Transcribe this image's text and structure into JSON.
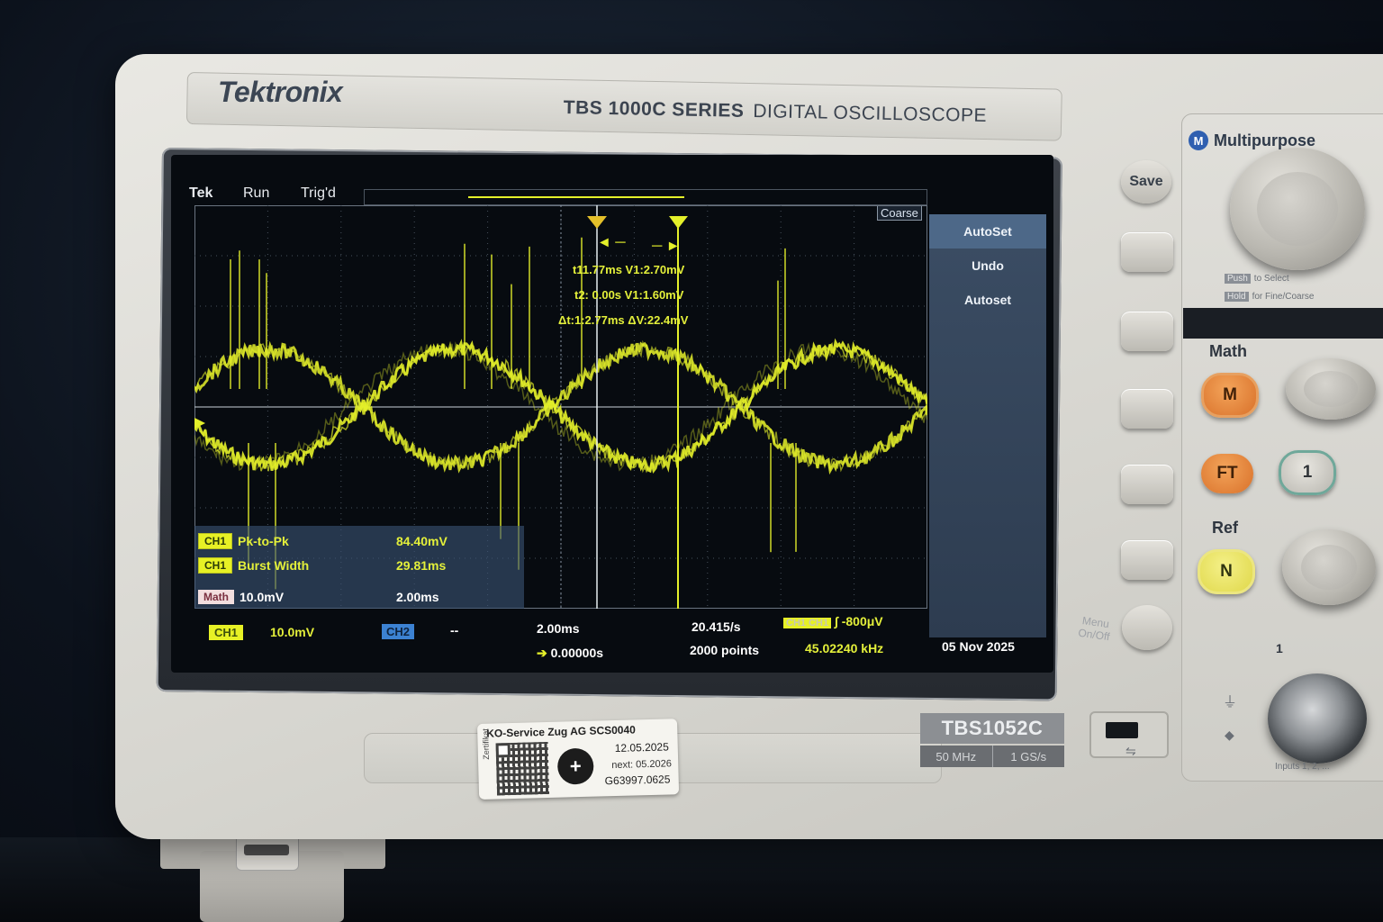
{
  "brand": "Tektronix",
  "series": {
    "name": "TBS 1000C SERIES",
    "desc": "DIGITAL OSCILLOSCOPE"
  },
  "screen": {
    "header": {
      "tek": "Tek",
      "run": "Run",
      "trig": "Trig'd",
      "coarse": "Coarse"
    },
    "cursors": {
      "line1": "t11.77ms V1:2.70mV",
      "line2": "t2: 0.00s V1:1.60mV",
      "line3": "Δt:1:2.77ms ΔV:22.4mV"
    },
    "side_menu": [
      "AutoSet",
      "Undo",
      "Autoset"
    ],
    "measurements": [
      {
        "channel": "CH1",
        "label": "Pk-to-Pk",
        "value": "84.40mV"
      },
      {
        "channel": "CH1",
        "label": "Burst Width",
        "value": "29.81ms"
      }
    ],
    "math_row": {
      "tag": "Math",
      "scale": "10.0mV",
      "time": "2.00ms"
    },
    "status": {
      "ch1_tag": "CH1",
      "ch1_scale": "10.0mV",
      "ch2_tag": "CH2",
      "ch2_scale": "--",
      "timebase": "2.00ms",
      "delay": "0.00000s",
      "sample_rate": "20.415/s",
      "record": "2000 points",
      "trig_tag": "CH1 CH1",
      "trig_level": "-800μV",
      "frequency": "45.02240 kHz",
      "date": "05 Nov 2025"
    }
  },
  "front_panel": {
    "save_label": "Save",
    "menu_onoff": "Menu On/Off",
    "multipurpose": "Multipurpose",
    "mp_badge": "M",
    "push_tag": "Push",
    "push_text": "to Select",
    "hold_tag": "Hold",
    "hold_text": "for Fine/Coarse",
    "math_label": "Math",
    "math_btn": "M",
    "ft_btn": "FT",
    "ch1_btn": "1",
    "ref_label": "Ref",
    "ref_btn": "N",
    "input_num": "1",
    "inputs_lbl": "Inputs 1, 2, ..."
  },
  "model": {
    "name": "TBS1052C",
    "bandwidth": "50 MHz",
    "sample": "1 GS/s"
  },
  "sticker": {
    "title": "KO-Service Zug AG SCS0040",
    "zert": "Zertifikat",
    "date": "12.05.2025",
    "next": "next: 05.2026",
    "id": "G63997.0625"
  },
  "colors": {
    "trace": "#e4f02a",
    "menu": "#3b4d64",
    "case": "#e0dfda"
  }
}
